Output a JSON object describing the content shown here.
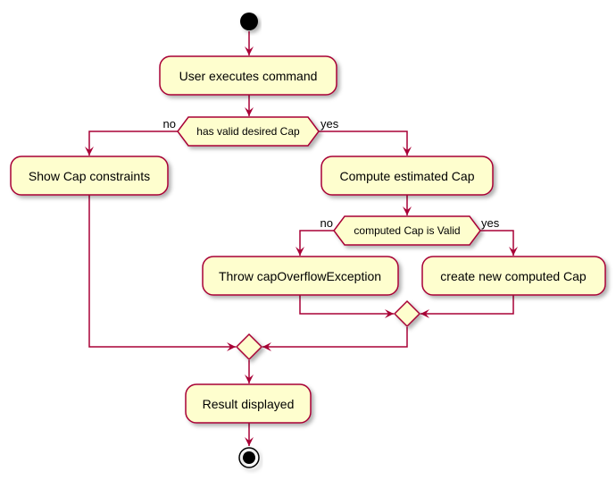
{
  "colors": {
    "fill": "#FEFECE",
    "border": "#A80036",
    "line": "#A80036"
  },
  "diagram": {
    "type": "activity",
    "nodes": {
      "start": "start",
      "user_executes": "User executes command",
      "cond1": "has valid desired Cap",
      "cond1_no": "no",
      "cond1_yes": "yes",
      "show_constraints": "Show Cap constraints",
      "compute": "Compute estimated Cap",
      "cond2": "computed Cap is Valid",
      "cond2_no": "no",
      "cond2_yes": "yes",
      "throw": "Throw capOverflowException",
      "create": "create new computed Cap",
      "result": "Result displayed",
      "end": "stop"
    }
  }
}
